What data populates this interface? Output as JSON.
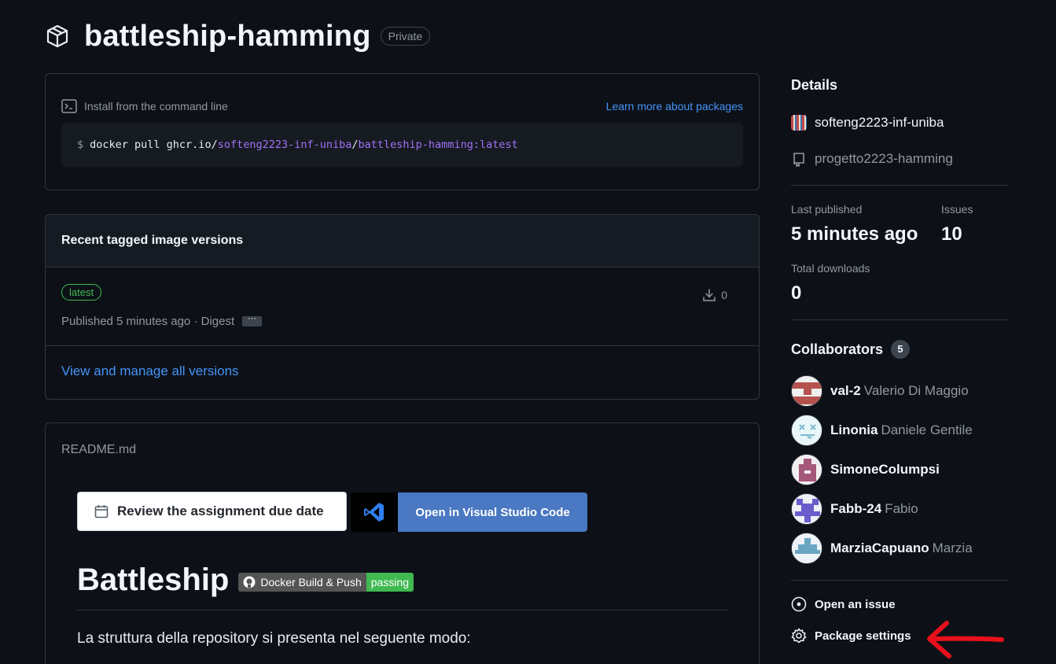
{
  "package": {
    "name": "battleship-hamming",
    "visibility": "Private"
  },
  "install": {
    "label": "Install from the command line",
    "learn_more": "Learn more about packages",
    "cmd_prefix": "$",
    "cmd_plain": "docker pull ghcr.io/",
    "cmd_org": "softeng2223-inf-uniba",
    "cmd_slash": "/",
    "cmd_image": "battleship-hamming:latest"
  },
  "versions": {
    "heading": "Recent tagged image versions",
    "items": [
      {
        "tag": "latest",
        "published": "Published 5 minutes ago · Digest",
        "downloads": "0"
      }
    ],
    "view_all": "View and manage all versions"
  },
  "readme": {
    "filename": "README.md",
    "review_button": "Review the assignment due date",
    "vscode_button": "Open in Visual Studio Code",
    "heading": "Battleship",
    "badge_left": "Docker Build & Push",
    "badge_right": "passing",
    "paragraph": "La struttura della repository si presenta nel seguente modo:"
  },
  "sidebar": {
    "details_title": "Details",
    "org": "softeng2223-inf-uniba",
    "repo": "progetto2223-hamming",
    "last_published_label": "Last published",
    "last_published_value": "5 minutes ago",
    "issues_label": "Issues",
    "issues_value": "10",
    "downloads_label": "Total downloads",
    "downloads_value": "0",
    "collaborators_title": "Collaborators",
    "collaborators_count": "5",
    "collaborators": [
      {
        "login": "val-2",
        "name": "Valerio Di Maggio"
      },
      {
        "login": "Linonia",
        "name": "Daniele Gentile"
      },
      {
        "login": "SimoneColumpsi",
        "name": ""
      },
      {
        "login": "Fabb-24",
        "name": "Fabio"
      },
      {
        "login": "MarziaCapuano",
        "name": "Marzia"
      }
    ],
    "open_issue": "Open an issue",
    "package_settings": "Package settings"
  },
  "colors": {
    "background": "#0d1117",
    "link": "#4493f8",
    "accent_green": "#3fb950",
    "annotation_arrow": "#e8101a"
  }
}
